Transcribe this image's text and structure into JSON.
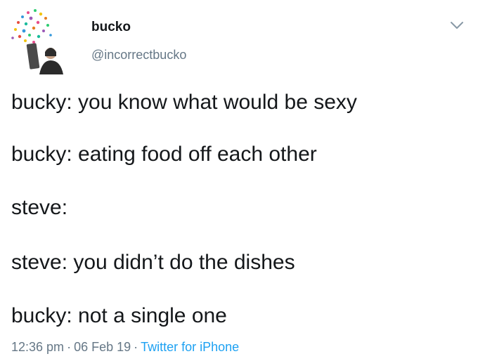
{
  "user": {
    "display_name": "bucko",
    "handle": "@incorrectbucko"
  },
  "menu": {
    "icon": "chevron-down-icon"
  },
  "tweet": {
    "lines": [
      "bucky: you know what would be sexy",
      "bucky: eating food off each other",
      "steve:",
      "steve: you didn’t do the dishes",
      "bucky: not a single one"
    ],
    "time": "12:36 pm",
    "date": "06 Feb 19",
    "separator": "·",
    "source": "Twitter for iPhone"
  },
  "colors": {
    "text": "#14171a",
    "secondary": "#657786",
    "link": "#1da1f2"
  }
}
